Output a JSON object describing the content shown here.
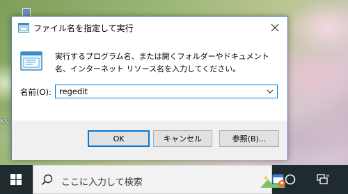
{
  "dialog": {
    "title": "ファイル名を指定して実行",
    "description": "実行するプログラム名、または開くフォルダーやドキュメント名、インターネット リソース名を入力してください。",
    "open_label": "名前(O):",
    "open_value": "regedit",
    "buttons": {
      "ok": "OK",
      "cancel": "キャンセル",
      "browse": "参照(B)..."
    },
    "icons": [
      "run-icon",
      "close-icon",
      "chevron-down-icon"
    ]
  },
  "taskbar": {
    "search_placeholder": "ここに入力して検索",
    "icons": [
      "windows-start-icon",
      "search-icon",
      "search-highlight-icon",
      "cortana-circle-icon",
      "task-view-icon"
    ]
  },
  "desktop": {
    "edge_text": "KN"
  },
  "colors": {
    "accent": "#0078d7",
    "taskbar": "#1f2b2f",
    "footer": "#f0f0f0"
  }
}
